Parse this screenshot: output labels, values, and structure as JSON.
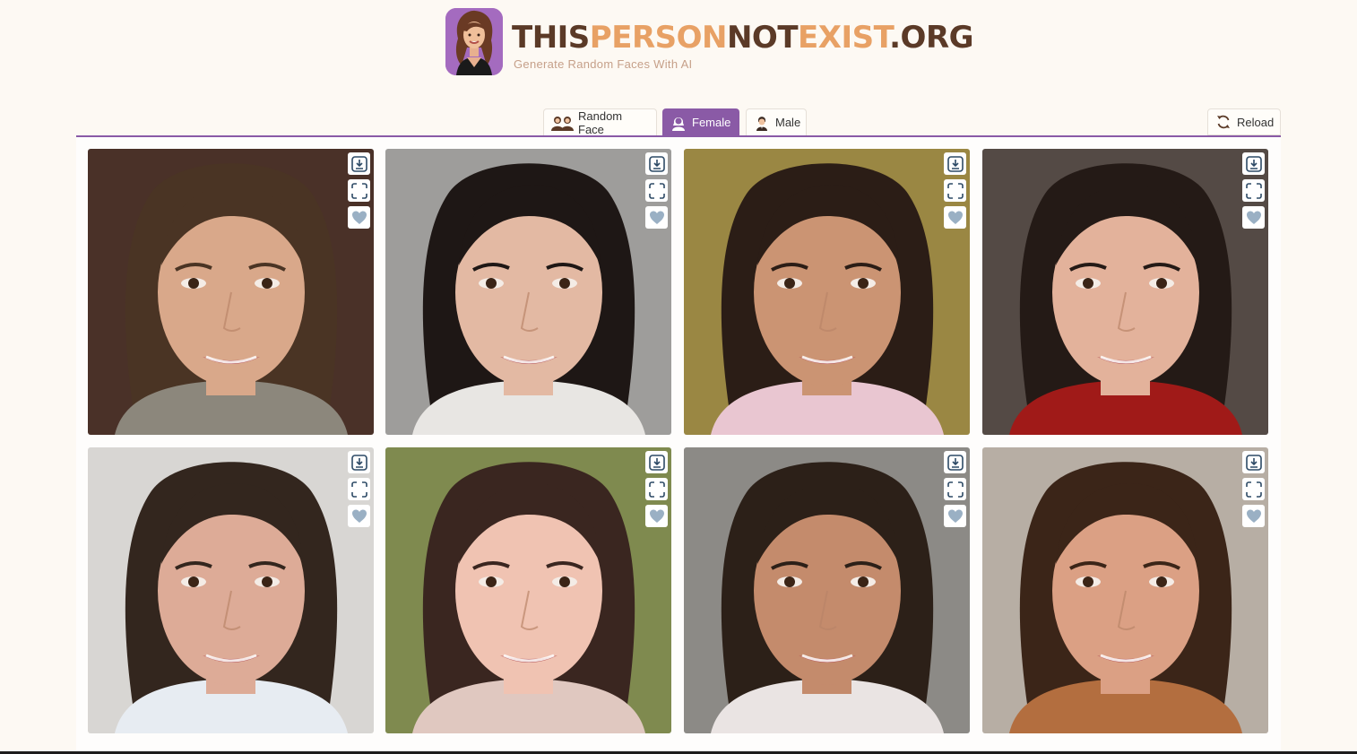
{
  "site": {
    "title_part1": "THIS",
    "title_part2": "PERSON",
    "title_part3": "NOT",
    "title_part4": "EXIST",
    "title_part5": ".ORG",
    "subtitle": "Generate Random Faces With AI"
  },
  "tabs": [
    {
      "label": "Random Face",
      "icon": "two-people-icon",
      "active": false
    },
    {
      "label": "Female",
      "icon": "female-user-icon",
      "active": true
    },
    {
      "label": "Male",
      "icon": "male-user-icon",
      "active": false
    }
  ],
  "reload": {
    "label": "Reload",
    "icon": "reload-icon"
  },
  "colors": {
    "accent": "#8a5aa6",
    "title_dark": "#5b3a27",
    "title_light": "#e8a165",
    "background": "#fdf9f3",
    "action_icon": "#2d4a66",
    "heart": "#9ab0c4"
  },
  "gallery": {
    "card_actions": [
      "download-icon",
      "fullscreen-icon",
      "heart-icon"
    ],
    "faces": [
      {
        "bg": "#4a3128",
        "skin": "#d9a88a",
        "hair": "#4a3424",
        "shirt": "#8c877c"
      },
      {
        "bg": "#9e9d9b",
        "skin": "#e3b9a3",
        "hair": "#1e1715",
        "shirt": "#e8e6e3"
      },
      {
        "bg": "#9a8743",
        "skin": "#cb9473",
        "hair": "#2b1d16",
        "shirt": "#e9c6d1"
      },
      {
        "bg": "#544a45",
        "skin": "#e3b29b",
        "hair": "#241a16",
        "shirt": "#a01a18"
      },
      {
        "bg": "#d8d6d3",
        "skin": "#ddab97",
        "hair": "#33261e",
        "shirt": "#e7ecf2"
      },
      {
        "bg": "#7f8a4f",
        "skin": "#f0c3b2",
        "hair": "#3a2620",
        "shirt": "#e0c8c0"
      },
      {
        "bg": "#8c8a86",
        "skin": "#c48b6c",
        "hair": "#2c2018",
        "shirt": "#eae4e3"
      },
      {
        "bg": "#b7aea4",
        "skin": "#dba084",
        "hair": "#3b2518",
        "shirt": "#b36e3f"
      }
    ]
  }
}
